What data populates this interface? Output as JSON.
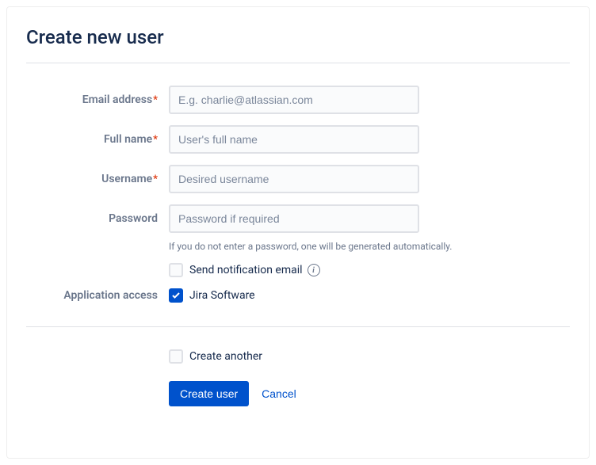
{
  "title": "Create new user",
  "fields": {
    "email": {
      "label": "Email address",
      "placeholder": "E.g. charlie@atlassian.com",
      "required": true
    },
    "fullname": {
      "label": "Full name",
      "placeholder": "User's full name",
      "required": true
    },
    "username": {
      "label": "Username",
      "placeholder": "Desired username",
      "required": true
    },
    "password": {
      "label": "Password",
      "placeholder": "Password if required",
      "required": false,
      "help": "If you do not enter a password, one will be generated automatically."
    }
  },
  "send_notification": {
    "label": "Send notification email",
    "checked": false
  },
  "app_access": {
    "label": "Application access",
    "option_label": "Jira Software",
    "checked": true
  },
  "create_another": {
    "label": "Create another",
    "checked": false
  },
  "buttons": {
    "submit": "Create user",
    "cancel": "Cancel"
  }
}
